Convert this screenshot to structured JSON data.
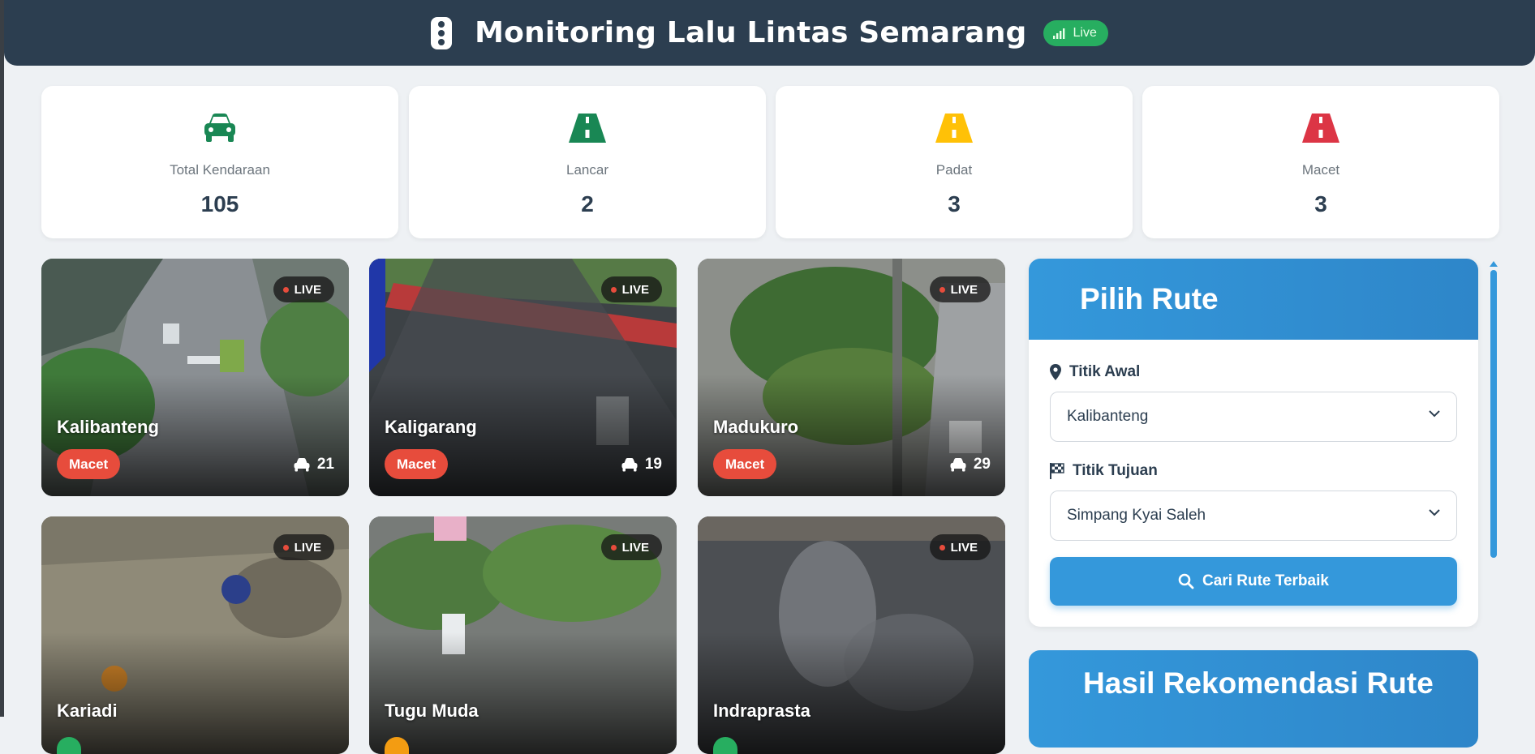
{
  "header": {
    "title": "Monitoring Lalu Lintas Semarang",
    "live_label": "Live"
  },
  "stats": [
    {
      "label": "Total Kendaraan",
      "value": "105",
      "icon": "car-icon",
      "color": "#198754"
    },
    {
      "label": "Lancar",
      "value": "2",
      "icon": "road-icon",
      "color": "#198754"
    },
    {
      "label": "Padat",
      "value": "3",
      "icon": "road-icon",
      "color": "#ffc107"
    },
    {
      "label": "Macet",
      "value": "3",
      "icon": "road-icon",
      "color": "#dc3545"
    }
  ],
  "cameras": [
    {
      "name": "Kalibanteng",
      "status": "Macet",
      "count": "21",
      "live": "LIVE"
    },
    {
      "name": "Kaligarang",
      "status": "Macet",
      "count": "19",
      "live": "LIVE"
    },
    {
      "name": "Madukuro",
      "status": "Macet",
      "count": "29",
      "live": "LIVE"
    },
    {
      "name": "Kariadi",
      "status": "",
      "count": "",
      "live": "LIVE"
    },
    {
      "name": "Tugu Muda",
      "status": "",
      "count": "",
      "live": "LIVE"
    },
    {
      "name": "Indraprasta",
      "status": "",
      "count": "",
      "live": "LIVE"
    }
  ],
  "status_colors": {
    "macet": "#e74c3c",
    "padat": "#f39c12",
    "lancar": "#27ae60"
  },
  "route_panel": {
    "title": "Pilih Rute",
    "origin_label": "Titik Awal",
    "origin_value": "Kalibanteng",
    "destination_label": "Titik Tujuan",
    "destination_value": "Simpang Kyai Saleh",
    "search_button": "Cari Rute Terbaik"
  },
  "result_panel": {
    "title": "Hasil Rekomendasi Rute"
  }
}
